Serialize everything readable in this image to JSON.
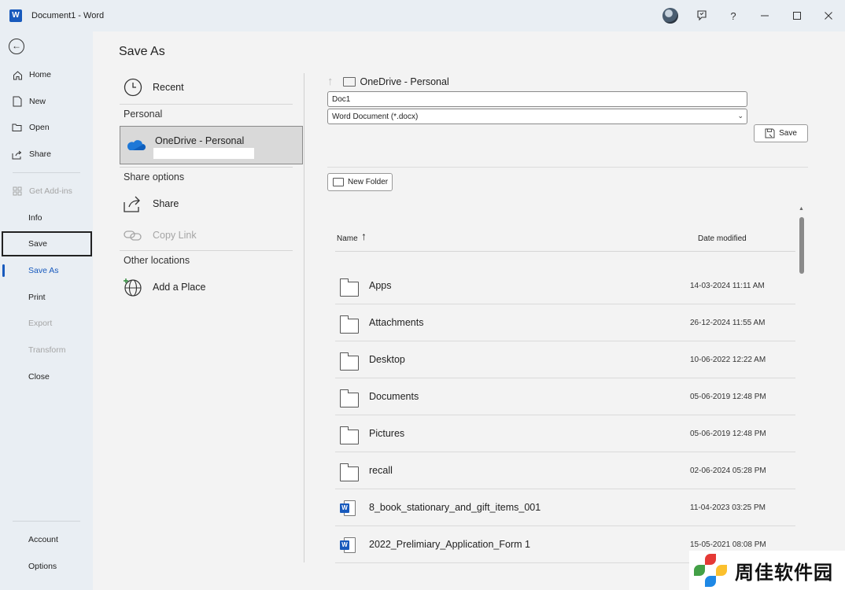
{
  "window": {
    "title": "Document1  -  Word",
    "app_icon": "word-icon"
  },
  "titlebar": {
    "icons": [
      "avatar",
      "feedback-icon",
      "help-icon",
      "minimize-icon",
      "maximize-icon",
      "close-icon"
    ],
    "help_glyph": "?"
  },
  "leftnav": {
    "back_icon": "back-arrow-icon",
    "items": [
      {
        "label": "Home",
        "icon": "home-icon"
      },
      {
        "label": "New",
        "icon": "new-doc-icon"
      },
      {
        "label": "Open",
        "icon": "folder-open-icon"
      },
      {
        "label": "Share",
        "icon": "share-icon"
      },
      {
        "label": "Get Add-ins",
        "icon": "addins-icon",
        "disabled": true
      },
      {
        "label": "Info"
      },
      {
        "label": "Save",
        "focused": true
      },
      {
        "label": "Save As",
        "active": true
      },
      {
        "label": "Print"
      },
      {
        "label": "Export",
        "disabled": true
      },
      {
        "label": "Transform",
        "disabled": true
      },
      {
        "label": "Close"
      }
    ],
    "bottom_items": [
      {
        "label": "Account"
      },
      {
        "label": "Options"
      }
    ]
  },
  "page_title": "Save As",
  "locations": {
    "recent": "Recent",
    "personal_header": "Personal",
    "onedrive": "OneDrive - Personal",
    "share_header": "Share options",
    "share": "Share",
    "copy_link": "Copy Link",
    "other_header": "Other locations",
    "add_place": "Add a Place"
  },
  "save_pane": {
    "path": "OneDrive - Personal",
    "filename": "Doc1",
    "file_type": "Word Document (*.docx)",
    "save_label": "Save",
    "new_folder_label": "New Folder"
  },
  "file_list": {
    "col_name": "Name",
    "col_date": "Date modified",
    "sort_arrow": "↑",
    "rows": [
      {
        "name": "Apps",
        "date": "14-03-2024 11:11 AM",
        "type": "folder"
      },
      {
        "name": "Attachments",
        "date": "26-12-2024 11:55 AM",
        "type": "folder"
      },
      {
        "name": "Desktop",
        "date": "10-06-2022 12:22 AM",
        "type": "folder"
      },
      {
        "name": "Documents",
        "date": "05-06-2019 12:48 PM",
        "type": "folder"
      },
      {
        "name": "Pictures",
        "date": "05-06-2019 12:48 PM",
        "type": "folder"
      },
      {
        "name": "recall",
        "date": "02-06-2024 05:28 PM",
        "type": "folder"
      },
      {
        "name": "8_book_stationary_and_gift_items_001",
        "date": "11-04-2023 03:25 PM",
        "type": "word"
      },
      {
        "name": "2022_Prelimiary_Application_Form 1",
        "date": "15-05-2021 08:08 PM",
        "type": "word"
      }
    ]
  },
  "watermark": {
    "text": "周佳软件园"
  },
  "colors": {
    "accent": "#185abd",
    "nav_bg": "#e9eef3",
    "main_bg": "#f3f3f3"
  }
}
